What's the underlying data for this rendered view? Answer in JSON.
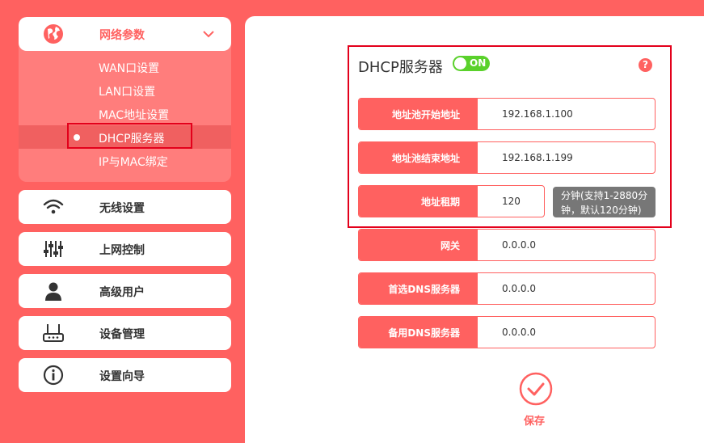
{
  "sidebar": {
    "network_group": {
      "label": "网络参数",
      "items": [
        "WAN口设置",
        "LAN口设置",
        "MAC地址设置",
        "DHCP服务器",
        "IP与MAC绑定"
      ]
    },
    "nav": [
      {
        "label": "无线设置",
        "icon": "wifi-icon"
      },
      {
        "label": "上网控制",
        "icon": "sliders-icon"
      },
      {
        "label": "高级用户",
        "icon": "user-icon"
      },
      {
        "label": "设备管理",
        "icon": "router-icon"
      },
      {
        "label": "设置向导",
        "icon": "info-icon"
      }
    ]
  },
  "dhcp": {
    "title": "DHCP服务器",
    "toggle": "ON",
    "help": "?",
    "fields": [
      {
        "label": "地址池开始地址",
        "value": "192.168.1.100"
      },
      {
        "label": "地址池结束地址",
        "value": "192.168.1.199"
      },
      {
        "label": "地址租期",
        "value": "120"
      },
      {
        "label": "网关",
        "value": "0.0.0.0"
      },
      {
        "label": "首选DNS服务器",
        "value": "0.0.0.0"
      },
      {
        "label": "备用DNS服务器",
        "value": "0.0.0.0"
      }
    ],
    "lease_note_line1": "分钟(支持1-2880分",
    "lease_note_line2": "钟，默认120分钟)",
    "save_label": "保存"
  },
  "colors": {
    "accent": "#ff6160",
    "toggle_on": "#5ad12b",
    "highlight_box": "#e3001b"
  }
}
